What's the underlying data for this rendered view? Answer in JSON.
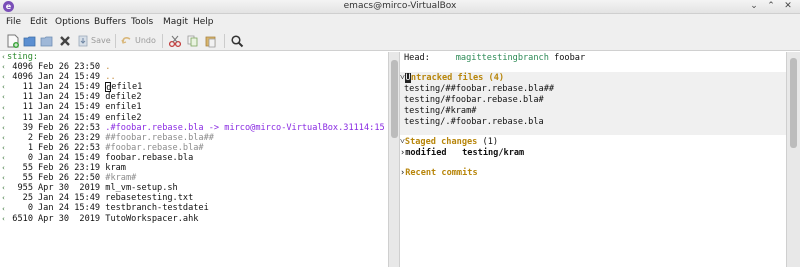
{
  "window": {
    "title": "emacs@mirco-VirtualBox",
    "app_icon_letter": "e",
    "controls": [
      "⌄",
      "⌃",
      "✕"
    ]
  },
  "menubar": [
    "File",
    "Edit",
    "Options",
    "Buffers",
    "Tools",
    "Magit",
    "Help"
  ],
  "toolbar": {
    "save_label": "Save",
    "undo_label": "Undo"
  },
  "left_buffer": {
    "header": "sting:",
    "lines": [
      {
        "size": "4096",
        "date": "Feb 26 23:50",
        "name": "."
      },
      {
        "size": "4096",
        "date": "Jan 24 15:49",
        "name": ".."
      },
      {
        "size": "11",
        "date": "Jan 24 15:49",
        "name_cursor": "d",
        "name_rest": "efile1"
      },
      {
        "size": "11",
        "date": "Jan 24 15:49",
        "name": "defile2"
      },
      {
        "size": "11",
        "date": "Jan 24 15:49",
        "name": "enfile1"
      },
      {
        "size": "11",
        "date": "Jan 24 15:49",
        "name": "enfile2"
      },
      {
        "size": "39",
        "date": "Feb 26 22:53",
        "name": ".#foobar.rebase.bla -> mirco@mirco-VirtualBox.31114:15"
      },
      {
        "size": "2",
        "date": "Feb 26 23:29",
        "name": "##foobar.rebase.bla##"
      },
      {
        "size": "1",
        "date": "Feb 26 22:53",
        "name": "#foobar.rebase.bla#"
      },
      {
        "size": "0",
        "date": "Jan 24 15:49",
        "name": "foobar.rebase.bla"
      },
      {
        "size": "55",
        "date": "Feb 26 23:19",
        "name": "kram"
      },
      {
        "size": "55",
        "date": "Feb 26 22:50",
        "name": "#kram#"
      },
      {
        "size": "955",
        "date": "Apr 30  2019",
        "name": "ml_vm-setup.sh"
      },
      {
        "size": "25",
        "date": "Jan 24 15:49",
        "name": "rebasetesting.txt"
      },
      {
        "size": "0",
        "date": "Jan 24 15:49",
        "name": "testbranch-testdatei"
      },
      {
        "size": "6510",
        "date": "Apr 30  2019",
        "name": "TutoWorkspacer.ahk"
      }
    ]
  },
  "magit": {
    "head_label": "Head:",
    "head_branch": "magittestingbranch",
    "head_commit": "foobar",
    "untracked_title_cursor": "U",
    "untracked_title_rest": "ntracked files (4)",
    "untracked_files": [
      "testing/##foobar.rebase.bla##",
      "testing/#foobar.rebase.bla#",
      "testing/#kram#",
      "testing/.#foobar.rebase.bla"
    ],
    "staged_title": "Staged changes",
    "staged_count": "(1)",
    "staged_status": "modified",
    "staged_file": "testing/kram",
    "recent_title": "Recent commits"
  },
  "colors": {
    "section_header": "#b8860b",
    "dired_green": "#2e8b2e",
    "symlink_purple": "#8a2be2",
    "backup_gray": "#8c8c8c"
  }
}
